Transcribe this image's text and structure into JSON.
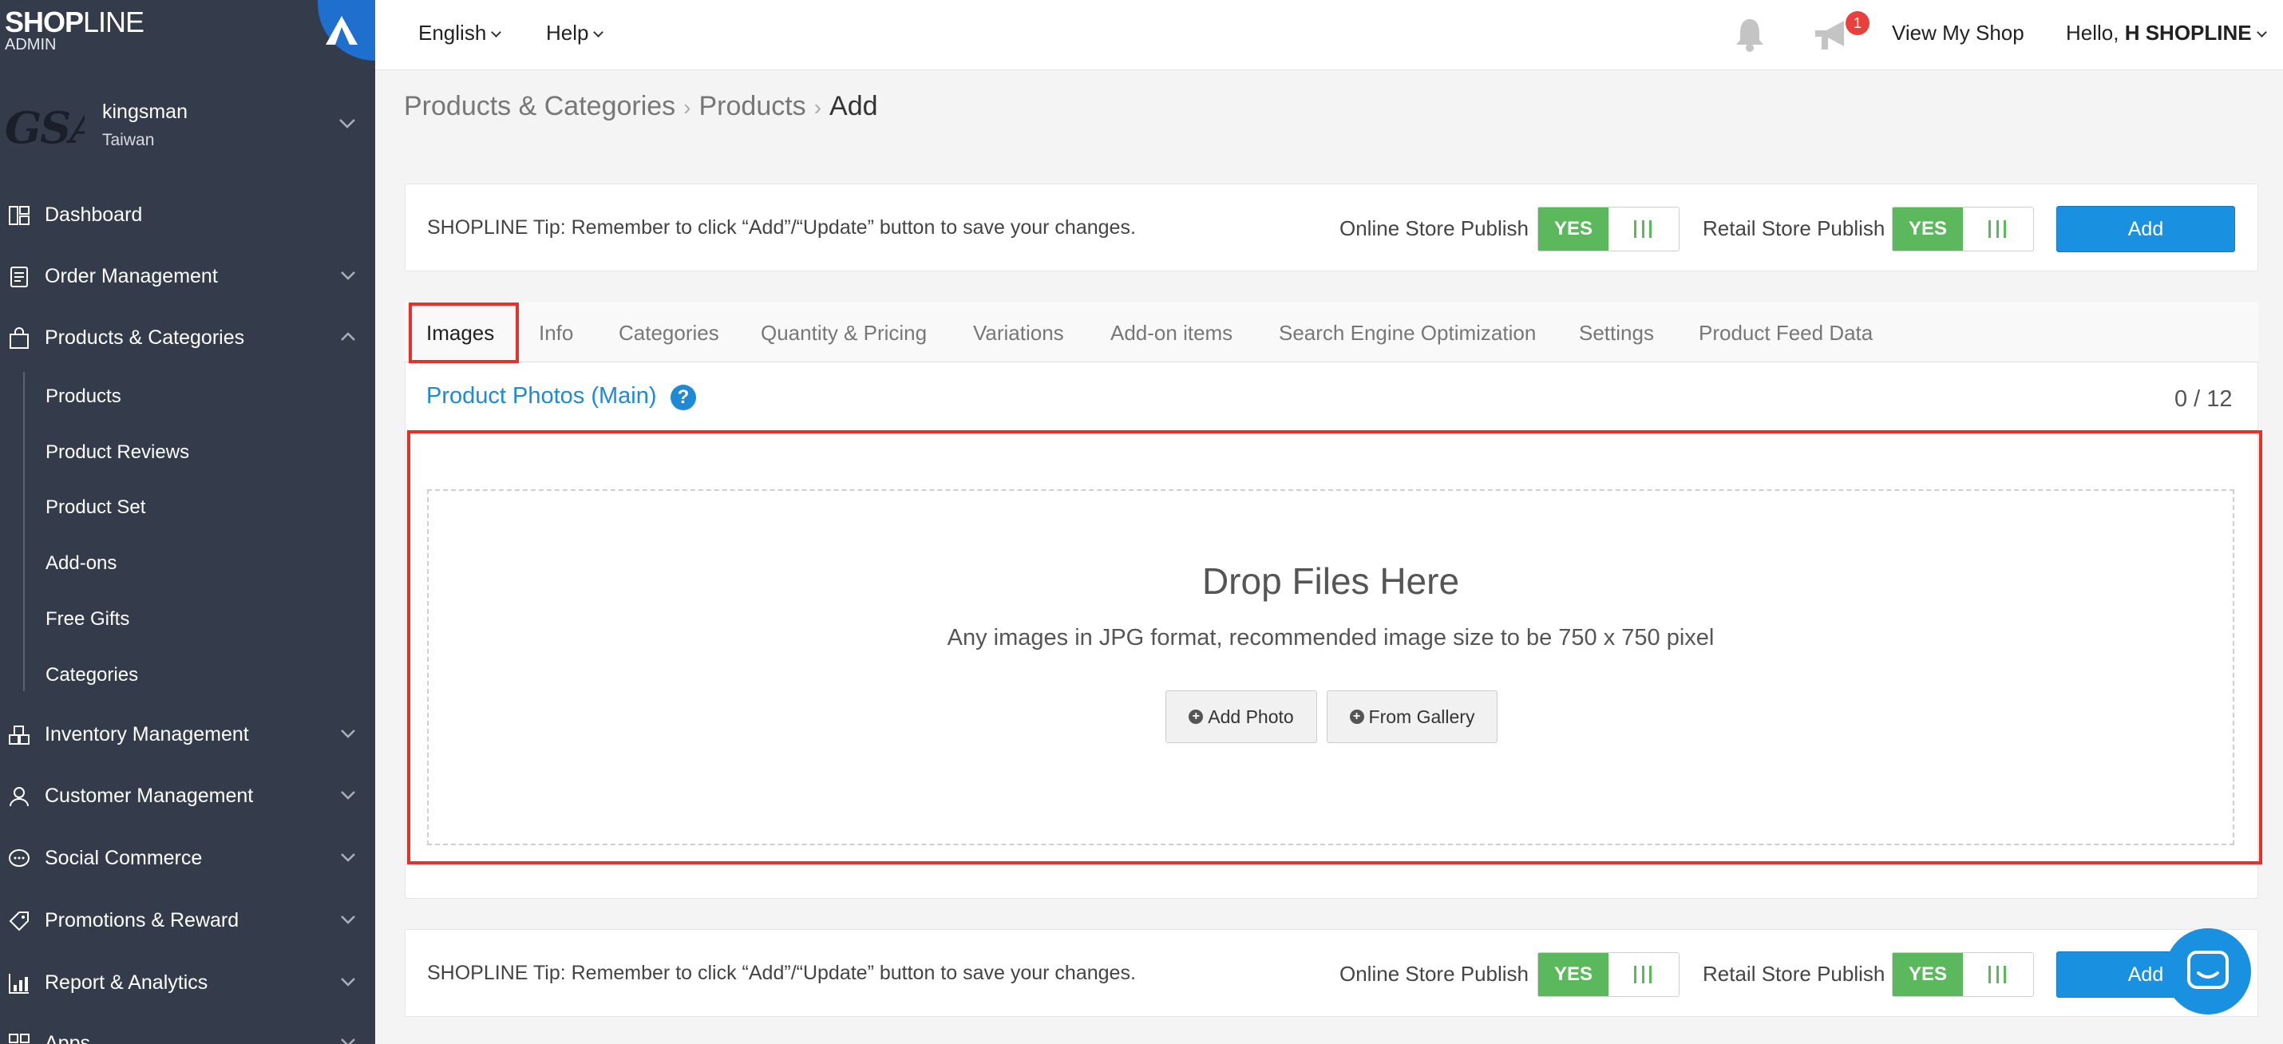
{
  "brand": {
    "logo_bold": "SHOP",
    "logo_light": "LINE",
    "sub": "ADMIN"
  },
  "store": {
    "avatar_text": "GSA",
    "name": "kingsman",
    "region": "Taiwan"
  },
  "sidebar": {
    "items": [
      {
        "label": "Dashboard",
        "icon": "dashboard-icon"
      },
      {
        "label": "Order Management",
        "icon": "order-icon"
      },
      {
        "label": "Products & Categories",
        "icon": "bag-icon"
      },
      {
        "label": "Inventory Management",
        "icon": "inventory-icon"
      },
      {
        "label": "Customer Management",
        "icon": "user-icon"
      },
      {
        "label": "Social Commerce",
        "icon": "chat-bubble-icon"
      },
      {
        "label": "Promotions & Reward",
        "icon": "tag-icon"
      },
      {
        "label": "Report & Analytics",
        "icon": "chart-icon"
      },
      {
        "label": "Apps",
        "icon": "apps-icon"
      }
    ],
    "sub_items": [
      "Products",
      "Product Reviews",
      "Product Set",
      "Add-ons",
      "Free Gifts",
      "Categories"
    ]
  },
  "topbar": {
    "language": "English",
    "help": "Help",
    "notification_count": "1",
    "view_shop": "View My Shop",
    "greeting": "Hello,",
    "user": "H SHOPLINE"
  },
  "breadcrumb": {
    "level1": "Products & Categories",
    "level2": "Products",
    "current": "Add"
  },
  "tipbar": {
    "tip": "SHOPLINE Tip: Remember to click “Add”/“Update” button to save your changes.",
    "online_label": "Online Store Publish",
    "retail_label": "Retail Store Publish",
    "toggle_on": "YES",
    "add_label": "Add"
  },
  "tabs": [
    "Images",
    "Info",
    "Categories",
    "Quantity & Pricing",
    "Variations",
    "Add-on items",
    "Search Engine Optimization",
    "Settings",
    "Product Feed Data"
  ],
  "photos": {
    "title": "Product Photos (Main)",
    "help": "?",
    "count": "0 / 12",
    "drop_title": "Drop Files Here",
    "drop_sub": "Any images in JPG format, recommended image size to be 750 x 750 pixel",
    "add_photo": "Add Photo",
    "from_gallery": "From Gallery"
  },
  "colors": {
    "sidebar": "#343c4b",
    "accent": "#1a90e0",
    "toggle_on": "#5cb85c",
    "highlight": "#e8302a"
  }
}
